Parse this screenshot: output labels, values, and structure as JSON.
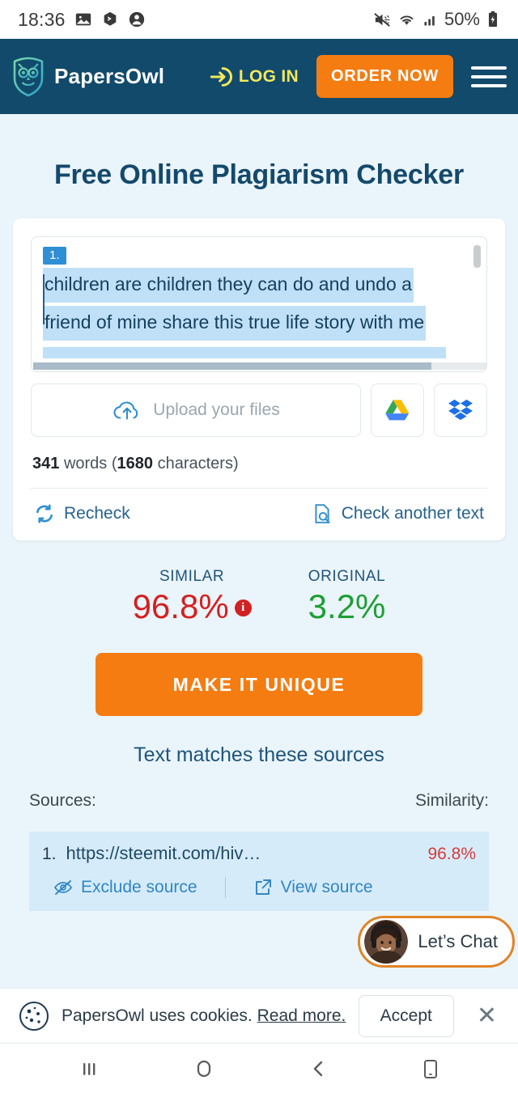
{
  "status_bar": {
    "time": "18:36",
    "battery_percent": "50%",
    "left_icons": [
      "gallery-icon",
      "chat-bubble-icon",
      "person-icon"
    ],
    "right_icons": [
      "mute-icon",
      "wifi-icon",
      "cellular-signal-icon",
      "battery-charging-icon"
    ]
  },
  "header": {
    "brand": "PapersOwl",
    "login_label": "LOG IN",
    "order_label": "ORDER NOW",
    "accent_orange": "#f57c11",
    "accent_yellow": "#f2e85c",
    "bg": "#114a6b"
  },
  "page": {
    "title": "Free Online Plagiarism Checker"
  },
  "editor": {
    "match_badge": "1.",
    "line1": "children are children they can do and undo a",
    "line2": "friend of mine share this true life story with me"
  },
  "upload": {
    "label": "Upload your files",
    "google_drive": "google-drive-icon",
    "dropbox": "dropbox-icon"
  },
  "counts": {
    "words": "341",
    "words_label": "words",
    "characters": "1680",
    "characters_label": "characters"
  },
  "actions": {
    "recheck": "Recheck",
    "check_another": "Check another text"
  },
  "stats": {
    "similar_label": "SIMILAR",
    "similar_value": "96.8%",
    "original_label": "ORIGINAL",
    "original_value": "3.2%",
    "similar_color": "#d32020",
    "original_color": "#1f9e33"
  },
  "cta": {
    "label": "MAKE IT UNIQUE"
  },
  "matches": {
    "title": "Text matches these sources",
    "col_sources": "Sources:",
    "col_similarity": "Similarity:",
    "rows": [
      {
        "index": "1.",
        "url": "https://steemit.com/hiv…",
        "similarity": "96.8%",
        "exclude_label": "Exclude source",
        "view_label": "View source"
      }
    ]
  },
  "chat_widget": {
    "label": "Let’s Chat",
    "border_color": "#e08426"
  },
  "cookie_bar": {
    "text": "PapersOwl uses cookies.",
    "read_more": "Read more.",
    "accept": "Accept",
    "close": "✕"
  },
  "nav_bar": {
    "recents": "recents-icon",
    "home": "home-icon",
    "back": "back-icon",
    "onehand": "phone-icon"
  }
}
